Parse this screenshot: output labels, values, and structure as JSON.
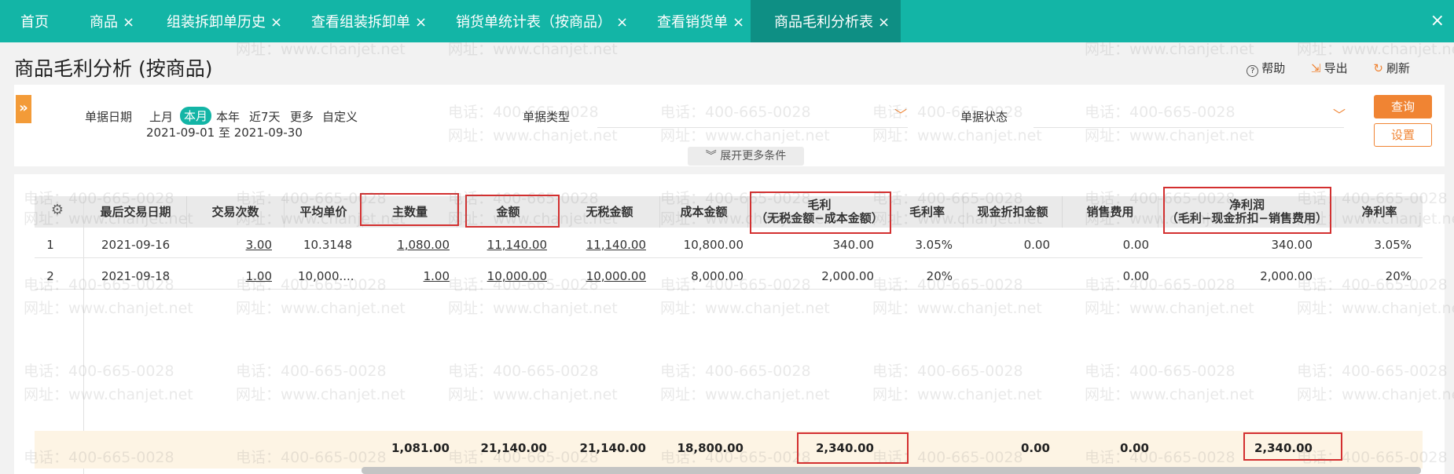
{
  "tabs": [
    {
      "label": "首页",
      "closable": false
    },
    {
      "label": "商品",
      "closable": true
    },
    {
      "label": "组装拆卸单历史",
      "closable": true
    },
    {
      "label": "查看组装拆卸单",
      "closable": true
    },
    {
      "label": "销货单统计表（按商品）",
      "closable": true
    },
    {
      "label": "查看销货单",
      "closable": true
    },
    {
      "label": "商品毛利分析表",
      "closable": true,
      "active": true
    }
  ],
  "close_glyph": "×",
  "page_title": "商品毛利分析 (按商品)",
  "tools": {
    "help": "帮助",
    "export": "导出",
    "refresh": "刷新"
  },
  "filter": {
    "date_label": "单据日期",
    "periods": [
      "上月",
      "本月",
      "本年",
      "近7天",
      "更多",
      "自定义"
    ],
    "active_period": "本月",
    "date_range": "2021-09-01 至 2021-09-30",
    "type_label": "单据类型",
    "status_label": "单据状态",
    "query_btn": "查询",
    "settings_btn": "设置",
    "more_conditions": "展开更多条件"
  },
  "table": {
    "columns": [
      "最后交易日期",
      "交易次数",
      "平均单价",
      "主数量",
      "金额",
      "无税金额",
      "成本金额",
      "毛利\n（无税金额−成本金额）",
      "毛利率",
      "现金折扣金额",
      "销售费用",
      "净利润\n（毛利−现金折扣−销售费用）",
      "净利率"
    ],
    "rows": [
      {
        "idx": "1",
        "date": "2021-09-16",
        "count": "3.00",
        "avg_price": "10.3148",
        "qty": "1,080.00",
        "amount": "11,140.00",
        "notax": "11,140.00",
        "cost": "10,800.00",
        "gross": "340.00",
        "gross_rate": "3.05%",
        "cash_disc": "0.00",
        "sales_fee": "0.00",
        "net": "340.00",
        "net_rate": "3.05%"
      },
      {
        "idx": "2",
        "date": "2021-09-18",
        "count": "1.00",
        "avg_price": "10,000....",
        "qty": "1.00",
        "amount": "10,000.00",
        "notax": "10,000.00",
        "cost": "8,000.00",
        "gross": "2,000.00",
        "gross_rate": "20%",
        "cash_disc": "",
        "sales_fee": "0.00",
        "net": "2,000.00",
        "net_rate": "20%"
      }
    ],
    "totals": {
      "qty": "1,081.00",
      "amount": "21,140.00",
      "notax": "21,140.00",
      "cost": "18,800.00",
      "gross": "2,340.00",
      "cash_disc": "0.00",
      "sales_fee": "0.00",
      "net": "2,340.00"
    }
  },
  "watermark": {
    "phone": "电话：400-665-0028",
    "site": "网址：www.chanjet.net"
  },
  "colors": {
    "tab_bar": "#13b5a6",
    "tab_active": "#0e8f84",
    "accent": "#f08433",
    "highlight": "#d32f2f",
    "totals_bg": "#fdf4e4"
  }
}
